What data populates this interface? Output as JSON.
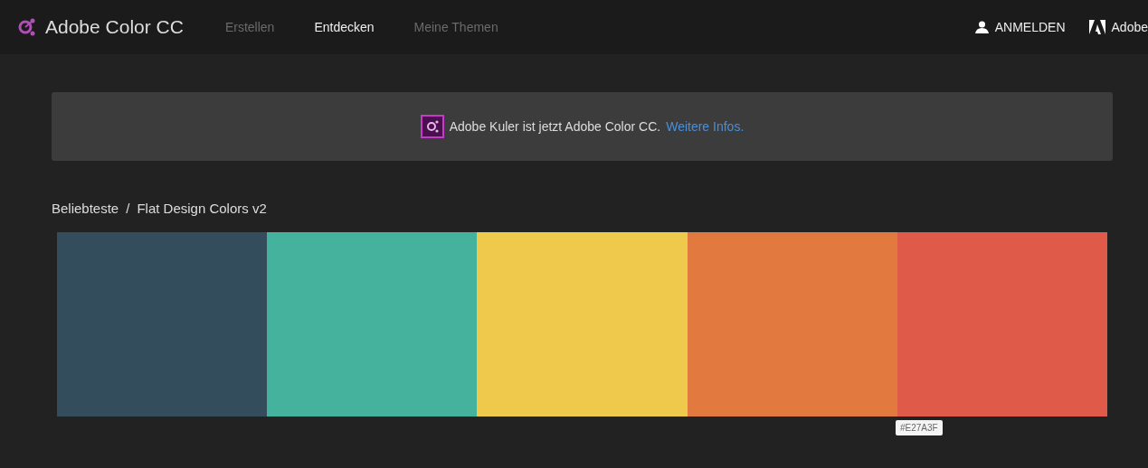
{
  "header": {
    "logo": "Adobe Color CC",
    "nav": [
      {
        "label": "Erstellen",
        "selected": false
      },
      {
        "label": "Entdecken",
        "selected": true
      },
      {
        "label": "Meine Themen",
        "selected": false
      }
    ],
    "login": "ANMELDEN",
    "adobe": "Adobe"
  },
  "banner": {
    "text": "Adobe Kuler ist jetzt Adobe Color CC.",
    "link": "Weitere Infos."
  },
  "breadcrumb": {
    "parent": "Beliebteste",
    "separator": "/",
    "current": "Flat Design Colors v2"
  },
  "swatches": [
    {
      "color": "#334d5c"
    },
    {
      "color": "#45b29d"
    },
    {
      "color": "#efc94c"
    },
    {
      "color": "#e27a3f"
    },
    {
      "color": "#df5a49"
    }
  ],
  "tooltip": "#E27A3F"
}
